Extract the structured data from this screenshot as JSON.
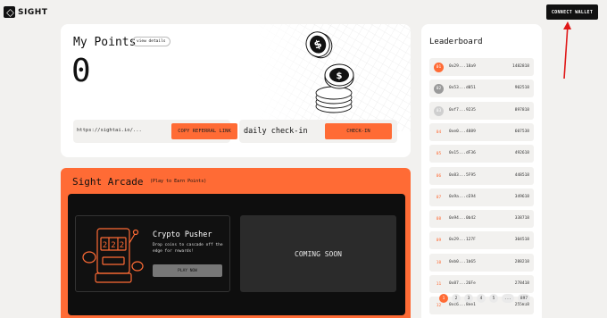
{
  "brand": {
    "name": "SIGHT"
  },
  "header": {
    "connect_label": "CONNECT WALLET"
  },
  "points": {
    "title": "My Points",
    "view_details": "view details",
    "value": "0",
    "referral_url": "https://sightai.io/...",
    "copy_label": "COPY REFERRAL LINK",
    "checkin_label": "daily check-in",
    "checkin_button": "CHECK-IN"
  },
  "arcade": {
    "title": "Sight Arcade",
    "subtitle": "(Play to Earn Points)",
    "game": {
      "name": "Crypto Pusher",
      "description": "Drop coins to cascade off the edge for rewards!",
      "play_label": "PLAY NOW"
    },
    "coming_soon": "COMING SOON"
  },
  "leaderboard": {
    "title": "Leaderboard",
    "rows": [
      {
        "rank": "01",
        "addr": "0x29...18a9",
        "score": "1482818"
      },
      {
        "rank": "02",
        "addr": "0x53...d051",
        "score": "902518"
      },
      {
        "rank": "03",
        "addr": "0xf7...9235",
        "score": "897818"
      },
      {
        "rank": "04",
        "addr": "0xe0...4889",
        "score": "607538"
      },
      {
        "rank": "05",
        "addr": "0x15...dF36",
        "score": "492618"
      },
      {
        "rank": "06",
        "addr": "0x83...5F95",
        "score": "448518"
      },
      {
        "rank": "07",
        "addr": "0x9a...cE94",
        "score": "349618"
      },
      {
        "rank": "08",
        "addr": "0x94...0b42",
        "score": "338718"
      },
      {
        "rank": "09",
        "addr": "0x29...127F",
        "score": "304518"
      },
      {
        "rank": "10",
        "addr": "0xb0...1b65",
        "score": "288218"
      },
      {
        "rank": "11",
        "addr": "0x87...26Fe",
        "score": "278418"
      },
      {
        "rank": "12",
        "addr": "0xc6...8ee1",
        "score": "255818"
      }
    ],
    "pages": [
      "1",
      "2",
      "3",
      "4",
      "5",
      "...",
      "897"
    ]
  },
  "colors": {
    "accent": "#ff6b35",
    "dark": "#0e0e0e",
    "bg": "#f2f1ef"
  }
}
